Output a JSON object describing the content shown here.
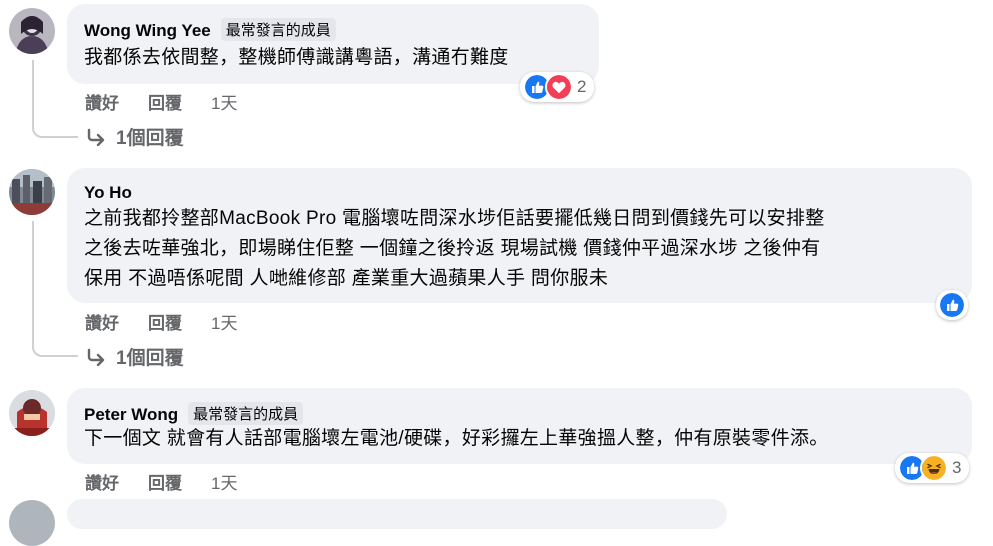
{
  "comments": [
    {
      "author": "Wong Wing Yee",
      "badge": "最常發言的成員",
      "text_lines": [
        "我都係去依間整，整機師傅識講粵語，溝通冇難度"
      ],
      "like_label": "讚好",
      "reply_label": "回覆",
      "time": "1天",
      "reaction_count": "2",
      "reaction_icons": [
        "like-icon",
        "love-icon"
      ],
      "replies_link": "1個回覆"
    },
    {
      "author": "Yo Ho",
      "badge": "",
      "text_lines": [
        "之前我都拎整部MacBook Pro 電腦壞咗問深水埗佢話要擺低幾日問到價錢先可以安排整",
        "之後去咗華強北，即場睇住佢整 一個鐘之後拎返 現場試機 價錢仲平過深水埗 之後仲有",
        "保用 不過唔係呢間 人哋維修部 產業重大過蘋果人手 問你服未"
      ],
      "like_label": "讚好",
      "reply_label": "回覆",
      "time": "1天",
      "reaction_count": "",
      "reaction_icons": [
        "like-icon"
      ],
      "replies_link": "1個回覆"
    },
    {
      "author": "Peter Wong",
      "badge": "最常發言的成員",
      "text_lines": [
        "下一個文 就會有人話部電腦壞左電池/硬碟，好彩攞左上華強搵人整，仲有原裝零件添。"
      ],
      "like_label": "讚好",
      "reply_label": "回覆",
      "time": "1天",
      "reaction_count": "3",
      "reaction_icons": [
        "like-icon",
        "haha-icon"
      ]
    }
  ],
  "colors": {
    "bubble": "#f0f2f5",
    "secondary_text": "#65676b",
    "like_blue": "#1877f2",
    "love_red": "#f33e58",
    "haha_yellow": "#f7b125"
  }
}
